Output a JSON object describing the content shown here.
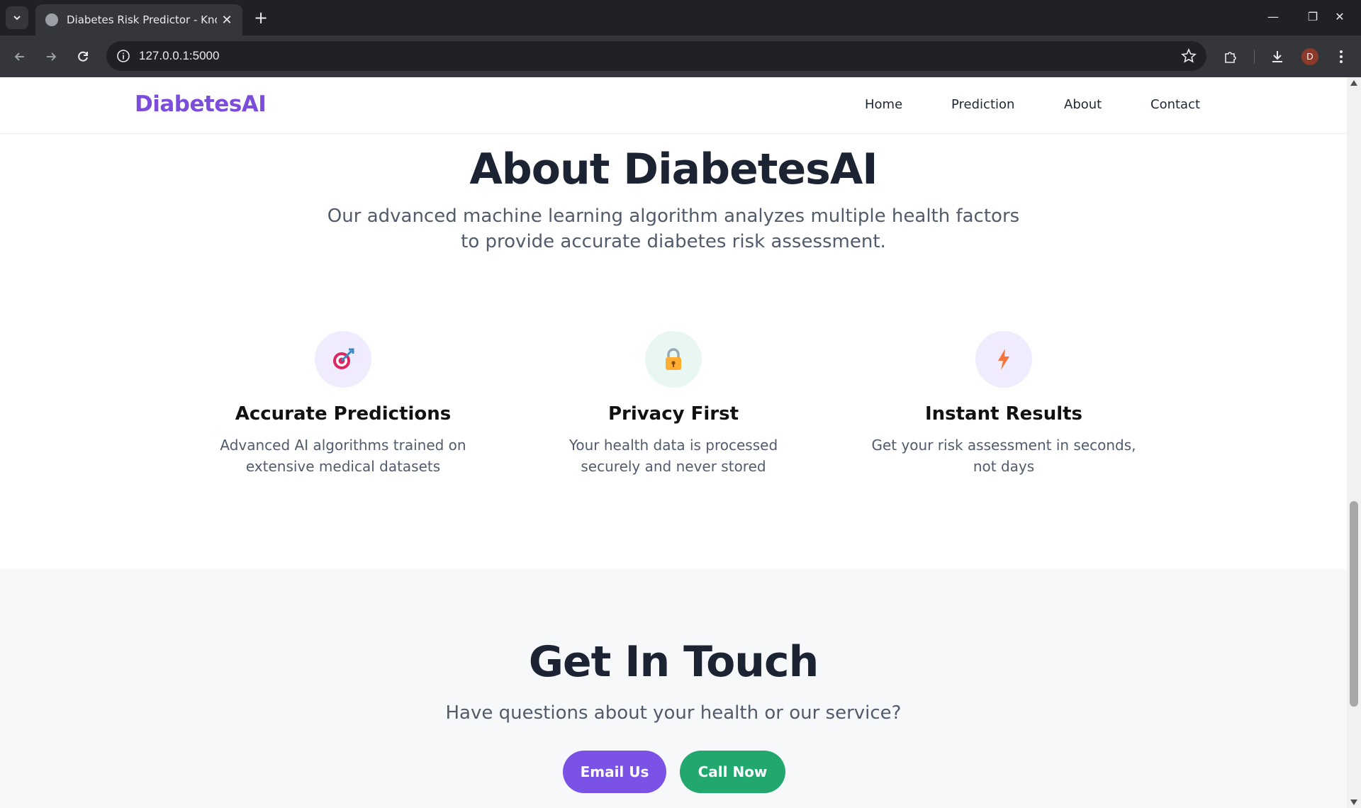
{
  "browser": {
    "tab_title": "Diabetes Risk Predictor - Know",
    "tab_close": "✕",
    "new_tab": "+",
    "url": "127.0.0.1:5000",
    "avatar_letter": "D",
    "window_controls": {
      "minimize": "—",
      "restore": "❐",
      "close": "✕"
    }
  },
  "site": {
    "brand": "DiabetesAI",
    "brand_color": "#7c4ddb",
    "nav": {
      "home": "Home",
      "prediction": "Prediction",
      "about": "About",
      "contact": "Contact"
    }
  },
  "about": {
    "title": "About DiabetesAI",
    "subtitle_line1": "Our advanced machine learning algorithm analyzes multiple health factors",
    "subtitle_line2": "to provide accurate diabetes risk assessment.",
    "features": [
      {
        "icon": "target-icon",
        "title": "Accurate Predictions",
        "desc_line1": "Advanced AI algorithms trained on",
        "desc_line2": "extensive medical datasets",
        "icon_bg": "#f1ecfd"
      },
      {
        "icon": "lock-icon",
        "title": "Privacy First",
        "desc_line1": "Your health data is processed",
        "desc_line2": "securely and never stored",
        "icon_bg": "#e9f7f2"
      },
      {
        "icon": "lightning-icon",
        "title": "Instant Results",
        "desc_line1": "Get your risk assessment in seconds,",
        "desc_line2": "not days",
        "icon_bg": "#f1ecfd"
      }
    ]
  },
  "contact": {
    "title": "Get In Touch",
    "subtitle": "Have questions about your health or our service?",
    "email_button": "Email Us",
    "call_button": "Call Now",
    "email_color": "#7b52e6",
    "call_color": "#22a86f"
  }
}
